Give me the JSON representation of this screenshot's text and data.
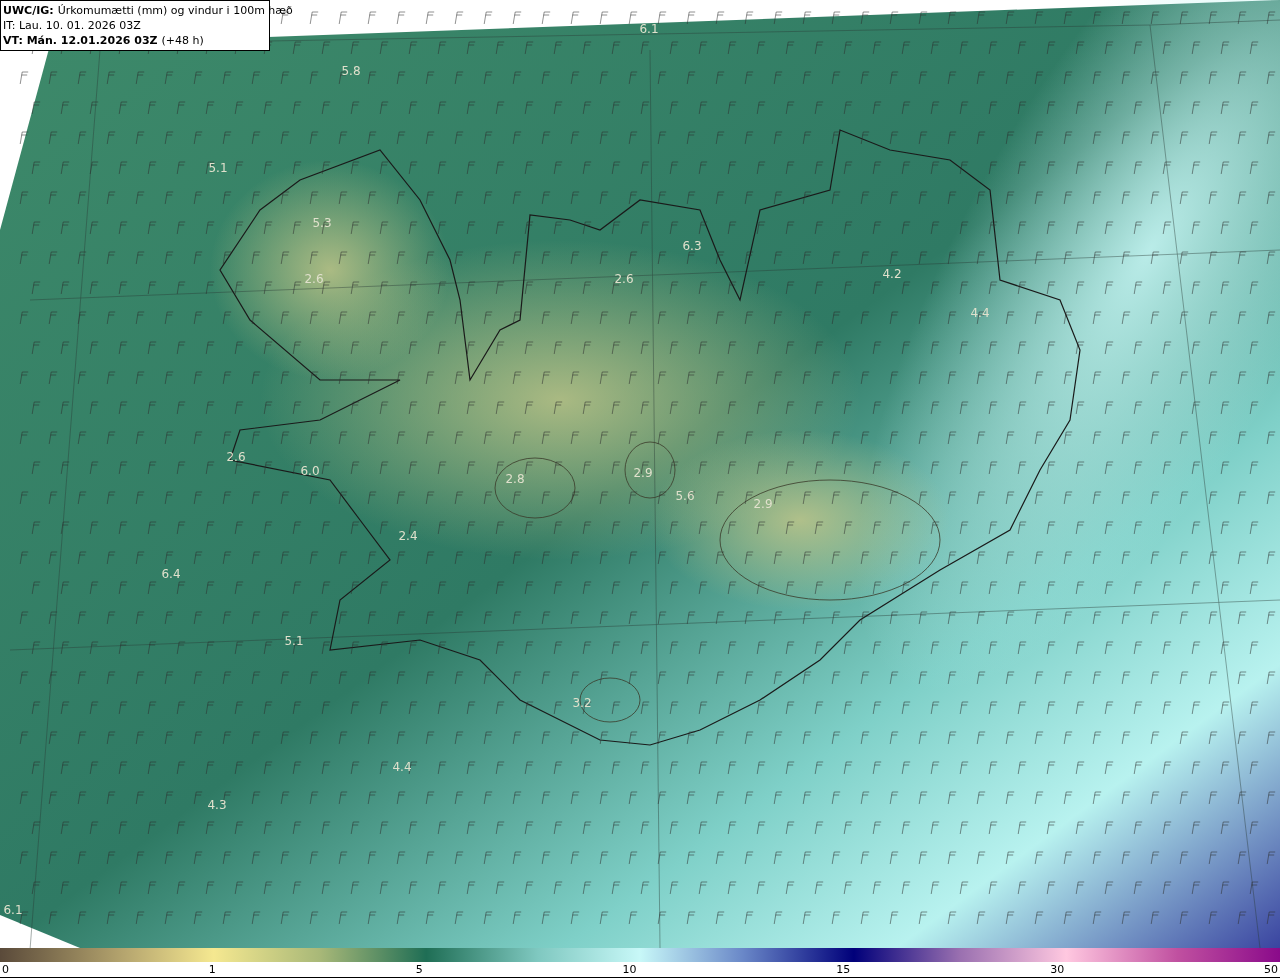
{
  "header": {
    "product": "UWC/IG:",
    "title": "Úrkomumætti (mm) og vindur i 100m hæð",
    "issue_time": "IT: Lau. 10. 01. 2026 03Z",
    "valid_label": "VT: Mán. 12.01.2026 03Z",
    "lead": "(+48 h)"
  },
  "map": {
    "value_labels": [
      "6.1",
      "5.8",
      "5.1",
      "5.3",
      "6.3",
      "2.6",
      "2.6",
      "4.2",
      "4.4",
      "2.6",
      "6.0",
      "2.8",
      "2.9",
      "5.6",
      "2.9",
      "2.4",
      "6.4",
      "5.1",
      "3.2",
      "4.4",
      "4.3",
      "6.1"
    ]
  },
  "legend": {
    "ticks": [
      "0",
      "1",
      "5",
      "10",
      "15",
      "30",
      "50"
    ]
  }
}
